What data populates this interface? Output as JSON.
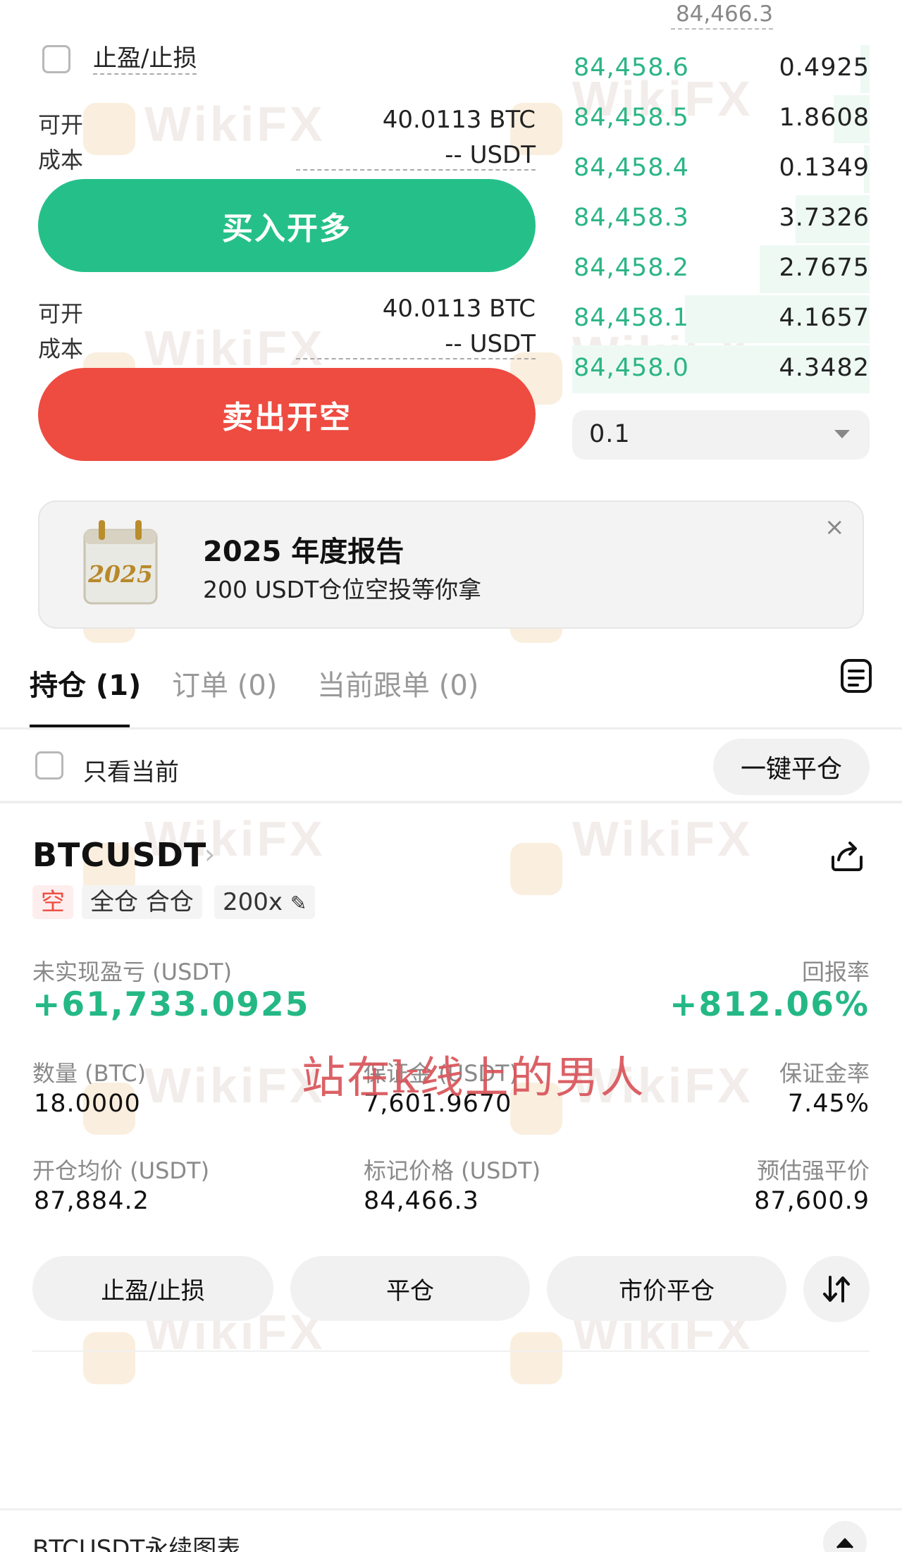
{
  "orderbook": {
    "top_price": "84,466.3",
    "rows": [
      {
        "price": "84,458.6",
        "qty": "0.4925",
        "depth": 0.03
      },
      {
        "price": "84,458.5",
        "qty": "1.8608",
        "depth": 0.12
      },
      {
        "price": "84,458.4",
        "qty": "0.1349",
        "depth": 0.02
      },
      {
        "price": "84,458.3",
        "qty": "3.7326",
        "depth": 0.25
      },
      {
        "price": "84,458.2",
        "qty": "2.7675",
        "depth": 0.37
      },
      {
        "price": "84,458.1",
        "qty": "4.1657",
        "depth": 0.62
      },
      {
        "price": "84,458.0",
        "qty": "4.3482",
        "depth": 1.0
      }
    ],
    "qty_step": "0.1"
  },
  "trade_panel": {
    "tp_sl_label": "止盈/止损",
    "buy": {
      "available_label": "可开",
      "available_value": "40.0113 BTC",
      "cost_label": "成本",
      "cost_value": "-- USDT",
      "button_label": "买入开多"
    },
    "sell": {
      "available_label": "可开",
      "available_value": "40.0113 BTC",
      "cost_label": "成本",
      "cost_value": "-- USDT",
      "button_label": "卖出开空"
    }
  },
  "banner": {
    "title": "2025 年度报告",
    "subtitle": "200 USDT仓位空投等你拿",
    "close": "×",
    "icon_text": "2025"
  },
  "tabs": [
    {
      "label": "持仓 (1)",
      "active": true
    },
    {
      "label": "订单 (0)",
      "active": false
    },
    {
      "label": "当前跟单 (0)",
      "active": false
    }
  ],
  "filter": {
    "label": "只看当前",
    "close_all": "一键平仓"
  },
  "position": {
    "symbol": "BTCUSDT",
    "chevron": "›",
    "tags": {
      "side": "空",
      "mode": "全仓 合仓",
      "leverage": "200x"
    },
    "pnl_label": "未实现盈亏 (USDT)",
    "pnl_value": "+61,733.0925",
    "roe_label": "回报率",
    "roe_value": "+812.06%",
    "qty_label": "数量 (BTC)",
    "qty_value": "18.0000",
    "margin_label": "保证金 (USDT)",
    "margin_value": "7,601.9670",
    "margin_rate_label": "保证金率",
    "margin_rate_value": "7.45%",
    "entry_label": "开仓均价 (USDT)",
    "entry_value": "87,884.2",
    "mark_label": "标记价格 (USDT)",
    "mark_value": "84,466.3",
    "liq_label": "预估强平价",
    "liq_value": "87,600.9",
    "actions": {
      "tp_sl": "止盈/止损",
      "close": "平仓",
      "market_close": "市价平仓"
    }
  },
  "overlay_text": "站在k线上的男人",
  "bottom": {
    "title": "BTCUSDT永续图表"
  },
  "watermark": {
    "text": "WikiFX"
  },
  "colors": {
    "green": "#25c08a",
    "red": "#ee4b41",
    "depth": "#eef9f4"
  }
}
